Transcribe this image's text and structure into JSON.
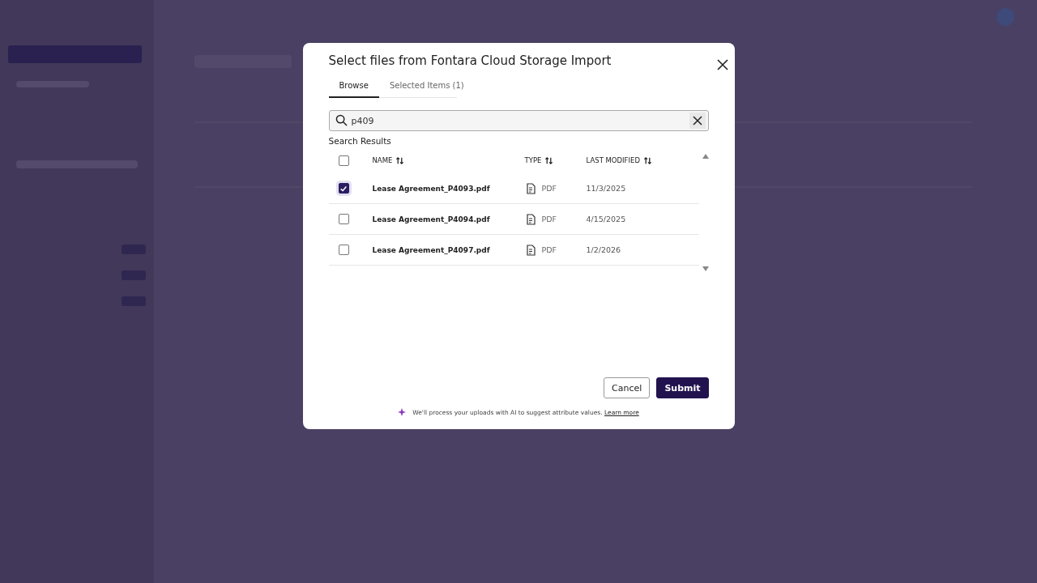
{
  "dialog": {
    "title": "Select files from Fontara Cloud Storage Import",
    "tabs": [
      {
        "label": "Browse",
        "selected": true
      },
      {
        "label": "Selected Items (1)",
        "selected": false
      }
    ],
    "search": {
      "value": "p409"
    },
    "results_heading": "Search Results",
    "table": {
      "select_all": {
        "checked": false
      },
      "columns": [
        "NAME",
        "TYPE",
        "LAST MODIFIED"
      ],
      "rows": [
        {
          "checked": true,
          "name": "Lease Agreement_P4093.pdf",
          "type": "PDF",
          "modified": "11/3/2025"
        },
        {
          "checked": false,
          "name": "Lease Agreement_P4094.pdf",
          "type": "PDF",
          "modified": "4/15/2025"
        },
        {
          "checked": false,
          "name": "Lease Agreement_P4097.pdf",
          "type": "PDF",
          "modified": "1/2/2026"
        }
      ]
    },
    "buttons": {
      "cancel": "Cancel",
      "submit": "Submit"
    },
    "footer": {
      "text": "We'll process your uploads with AI to suggest attribute values.",
      "link": "Learn more"
    }
  }
}
